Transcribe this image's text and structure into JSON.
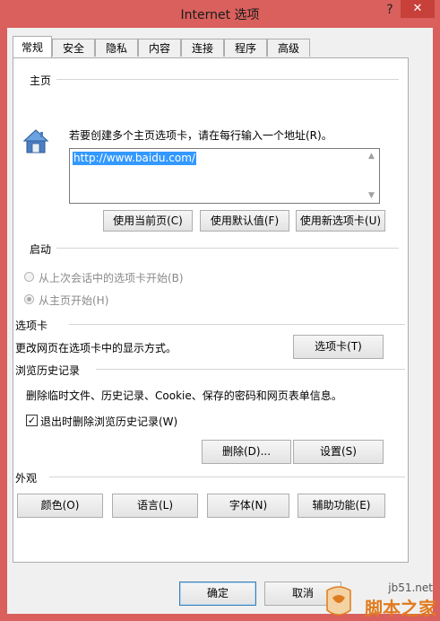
{
  "window": {
    "title": "Internet 选项",
    "help_glyph": "?",
    "close_glyph": "✕"
  },
  "tabs": [
    "常规",
    "安全",
    "隐私",
    "内容",
    "连接",
    "程序",
    "高级"
  ],
  "home": {
    "section_label": "主页",
    "hint": "若要创建多个主页选项卡，请在每行输入一个地址(R)。",
    "url": "http://www.baidu.com/",
    "buttons": {
      "use_current": "使用当前页(C)",
      "use_default": "使用默认值(F)",
      "use_new_tab": "使用新选项卡(U)"
    }
  },
  "startup": {
    "section_label": "启动",
    "option_last_session": "从上次会话中的选项卡开始(B)",
    "option_home": "从主页开始(H)",
    "selected": "option_home"
  },
  "tabs_section": {
    "section_label": "选项卡",
    "description": "更改网页在选项卡中的显示方式。",
    "button": "选项卡(T)"
  },
  "history": {
    "section_label": "浏览历史记录",
    "description": "删除临时文件、历史记录、Cookie、保存的密码和网页表单信息。",
    "checkbox_label": "退出时删除浏览历史记录(W)",
    "checkbox_checked": true,
    "delete_button": "删除(D)...",
    "settings_button": "设置(S)"
  },
  "appearance": {
    "section_label": "外观",
    "buttons": {
      "colors": "颜色(O)",
      "languages": "语言(L)",
      "fonts": "字体(N)",
      "accessibility": "辅助功能(E)"
    }
  },
  "footer": {
    "ok": "确定",
    "cancel": "取消"
  },
  "watermark": {
    "url": "jb51.net",
    "site_name": "脚本之家"
  },
  "colors": {
    "titlebar": "#d9605c",
    "close_button": "#c7403a",
    "selection": "#3399ff",
    "watermark": "#e07b1f"
  }
}
